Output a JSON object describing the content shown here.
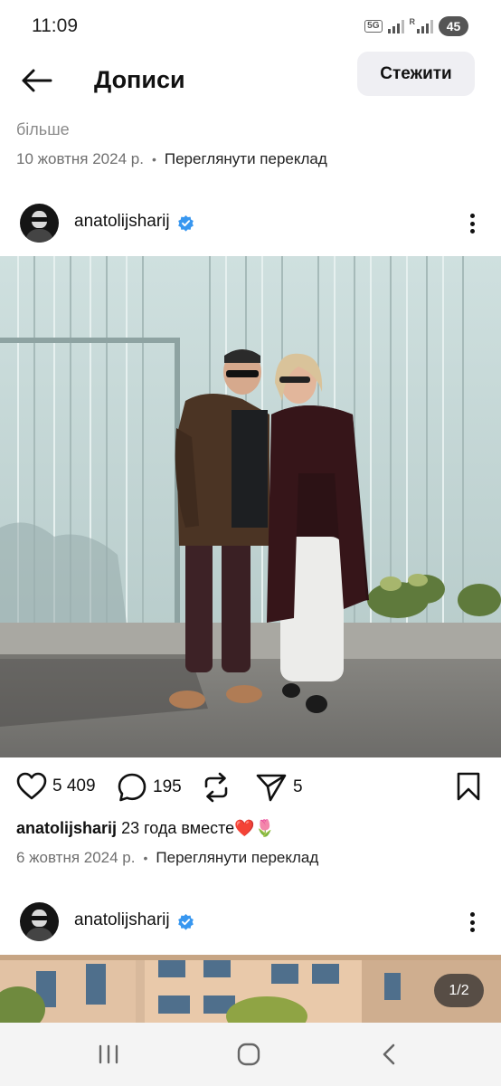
{
  "status": {
    "time": "11:09",
    "network": "5G",
    "roaming": "R",
    "battery": "45"
  },
  "header": {
    "title": "Дописи",
    "follow_label": "Стежити"
  },
  "prev_post": {
    "more_label": "більше",
    "date": "10 жовтня 2024 р.",
    "translate_label": "Переглянути переклад"
  },
  "post": {
    "username": "anatolijsharij",
    "verified": true,
    "likes": "5 409",
    "comments": "195",
    "shares": "5",
    "caption_user": "anatolijsharij",
    "caption_text": "23 года вместе❤️🌷",
    "date": "6 жовтня 2024 р.",
    "translate_label": "Переглянути переклад"
  },
  "next_post": {
    "username": "anatolijsharij",
    "verified": true,
    "media_counter": "1/2"
  },
  "colors": {
    "verified": "#3897f0",
    "follow_bg": "#efeff3",
    "nav_bg": "#f4f4f4"
  },
  "icons": [
    "back-arrow-icon",
    "verified-badge-icon",
    "more-vertical-icon",
    "heart-icon",
    "comment-bubble-icon",
    "repost-icon",
    "send-icon",
    "bookmark-icon",
    "recent-apps-icon",
    "home-icon",
    "back-nav-icon"
  ]
}
